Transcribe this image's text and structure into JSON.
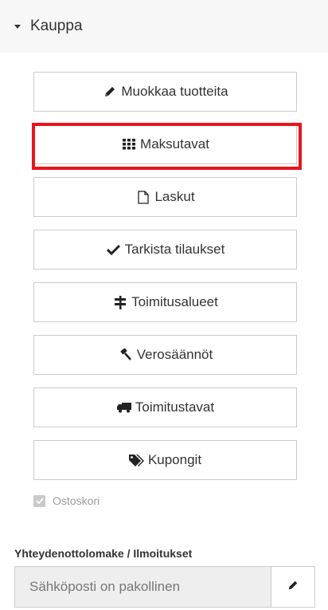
{
  "section": {
    "title": "Kauppa"
  },
  "buttons": [
    {
      "label": "Muokkaa tuotteita",
      "icon": "pencil-icon"
    },
    {
      "label": "Maksutavat",
      "icon": "grid-icon"
    },
    {
      "label": "Laskut",
      "icon": "file-icon"
    },
    {
      "label": "Tarkista tilaukset",
      "icon": "check-icon"
    },
    {
      "label": "Toimitusalueet",
      "icon": "signpost-icon"
    },
    {
      "label": "Verosäännöt",
      "icon": "gavel-icon"
    },
    {
      "label": "Toimitustavat",
      "icon": "truck-icon"
    },
    {
      "label": "Kupongit",
      "icon": "tags-icon"
    }
  ],
  "cart": {
    "label": "Ostoskori",
    "checked": true
  },
  "contact": {
    "label": "Yhteydenottolomake / Ilmoitukset",
    "value": "Sähköposti on pakollinen"
  },
  "colors": {
    "highlight": "#e8141e"
  }
}
